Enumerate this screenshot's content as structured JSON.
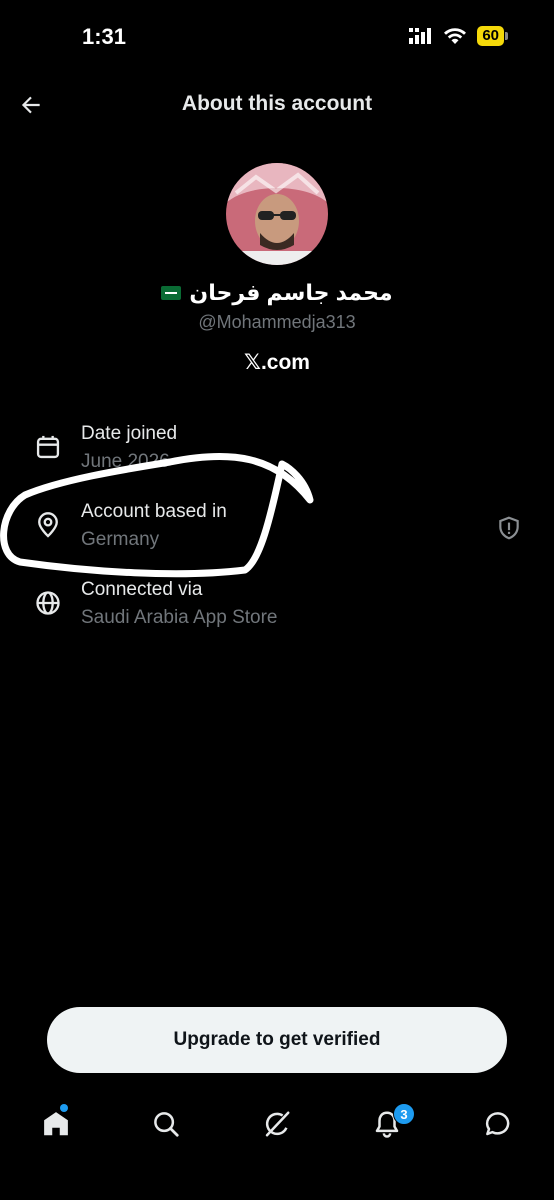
{
  "status_bar": {
    "time": "1:31",
    "battery": "60"
  },
  "header": {
    "title": "About this account"
  },
  "profile": {
    "display_name": "محمد جاسم فرحان",
    "handle": "@Mohammedja313",
    "domain": "𝕏.com"
  },
  "info": [
    {
      "label": "Date joined",
      "value": "June 2026",
      "icon": "calendar-icon"
    },
    {
      "label": "Account based in",
      "value": "Germany",
      "icon": "location-pin-icon"
    },
    {
      "label": "Connected via",
      "value": "Saudi Arabia App Store",
      "icon": "globe-icon"
    }
  ],
  "upgrade_button": {
    "label": "Upgrade to get verified"
  },
  "tabbar": {
    "notifications_badge": "3",
    "items": [
      "home-icon",
      "search-icon",
      "grok-icon",
      "bell-icon",
      "messages-icon"
    ]
  },
  "colors": {
    "accent": "#1d9bf0",
    "background": "#000000",
    "muted": "#71767b",
    "battery": "#f5d90a"
  }
}
